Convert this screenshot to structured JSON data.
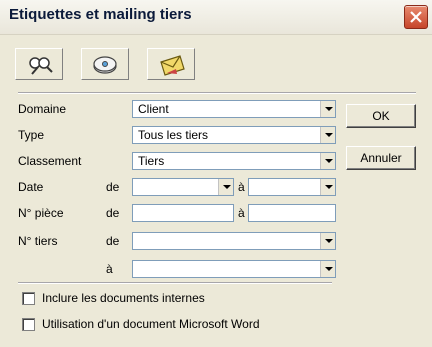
{
  "window": {
    "title": "Etiquettes et mailing tiers"
  },
  "toolbar": {
    "buttons": [
      {
        "icon": "search-people-icon"
      },
      {
        "icon": "disk-icon"
      },
      {
        "icon": "envelope-icon"
      }
    ]
  },
  "form": {
    "domaine": {
      "label": "Domaine",
      "value": "Client"
    },
    "type": {
      "label": "Type",
      "value": "Tous les tiers"
    },
    "classement": {
      "label": "Classement",
      "value": "Tiers"
    },
    "date": {
      "label": "Date",
      "de": "de",
      "a": "à",
      "from_value": "",
      "to_value": ""
    },
    "piece": {
      "label": "N° pièce",
      "de": "de",
      "a": "à",
      "from_value": "",
      "to_value": ""
    },
    "tiers": {
      "label": "N° tiers",
      "de": "de",
      "a": "à",
      "from_value": "",
      "to_value": ""
    }
  },
  "buttons": {
    "ok": "OK",
    "annuler": "Annuler"
  },
  "options": {
    "inclure": {
      "label": "Inclure les documents internes",
      "checked": false
    },
    "word": {
      "label": "Utilisation d'un document Microsoft Word",
      "checked": false
    }
  },
  "colors": {
    "close_button": "#c6452a",
    "field_border": "#7f9db9",
    "dialog_bg": "#ece9d8"
  }
}
